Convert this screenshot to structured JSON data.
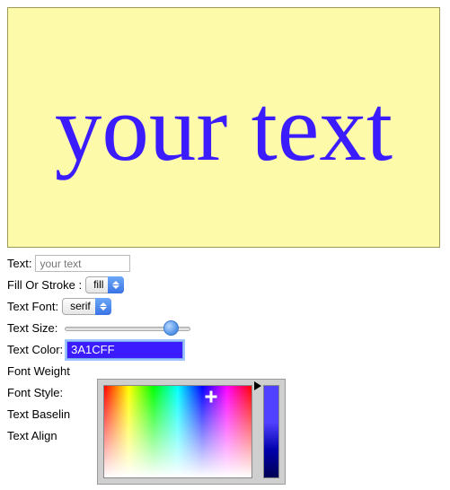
{
  "preview": {
    "text": "your text",
    "color": "#3A1CFF",
    "background": "#fdfaaa"
  },
  "controls": {
    "text_label": "Text:",
    "text_placeholder": "your text",
    "fill_or_stroke_label": "Fill Or Stroke :",
    "fill_or_stroke_value": "fill",
    "text_font_label": "Text Font:",
    "text_font_value": "serif",
    "text_size_label": "Text Size:",
    "text_size_value": 78,
    "text_color_label": "Text Color:",
    "text_color_value": "3A1CFF",
    "font_weight_label": "Font Weight",
    "font_style_label": "Font Style:",
    "text_baseline_label": "Text Baselin",
    "text_align_label": "Text Align"
  }
}
